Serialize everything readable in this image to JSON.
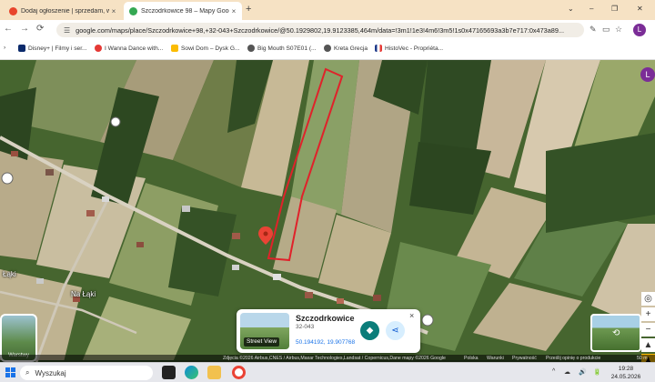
{
  "browser": {
    "tabs": [
      {
        "title": "Dodaj ogłoszenie | sprzedam, w...",
        "close": "×",
        "favicon_color": "#e8452c"
      },
      {
        "title": "Szczodrkowice 98 – Mapy Goog...",
        "close": "×",
        "favicon_color": "#34a853"
      }
    ],
    "new_tab": "+",
    "window_controls": [
      "⌄",
      "–",
      "❐",
      "✕"
    ],
    "nav": {
      "back": "←",
      "forward": "→",
      "reload": "⟳"
    },
    "address_url": "google.com/maps/place/Szczodrkowice+98,+32-043+Szczodrkowice/@50.1929802,19.9123385,464m/data=!3m1!1e3!4m6!3m5!1s0x47165693a3b7e717:0x473a89...",
    "profile_initial": "L",
    "bookmarks": [
      {
        "label": "Disney+ | Filmy i ser...",
        "color": "#0b2a6b"
      },
      {
        "label": "I Wanna Dance with...",
        "color": "#e53935"
      },
      {
        "label": "Sowi Dom – Dysk G...",
        "color": "#fbbc04"
      },
      {
        "label": "Big Mouth S07E01 (...",
        "color": "#555555"
      },
      {
        "label": "Kreta Grecja",
        "color": "#555555"
      },
      {
        "label": "HistoVec - Propriéta...",
        "color": "#1e3a8a"
      }
    ]
  },
  "map": {
    "place_labels": [
      "Łąki",
      "Na Łąki"
    ],
    "layers_label": "Warstwy",
    "profile_initial": "L",
    "controls": {
      "zoom_in": "+",
      "zoom_out": "−",
      "locate": "◎",
      "compass": "▲"
    },
    "info_card": {
      "name": "Szczodrkowice",
      "postal_code": "32-043",
      "coordinates": "50.194192, 19.907768",
      "street_view_label": "Street View",
      "close": "×"
    },
    "footer": {
      "attribution": "Zdjęcia ©2026 Airbus,CNES / Airbus,Maxar Technologies,Landsat / Copernicus,Dane mapy ©2026 Google",
      "links": [
        "Polska",
        "Warunki",
        "Prywatność",
        "Prześlij opinię o produkcie"
      ],
      "scale": "50 m"
    },
    "colors": {
      "outline": "#e0222a",
      "pin": "#ea4335",
      "directions": "#0b7d7a"
    }
  },
  "taskbar": {
    "search_placeholder": "Wyszukaj",
    "tray_icons": [
      "^",
      "☁",
      "🔊",
      "🔋"
    ],
    "time": "19:28",
    "date": "24.05.2026"
  }
}
